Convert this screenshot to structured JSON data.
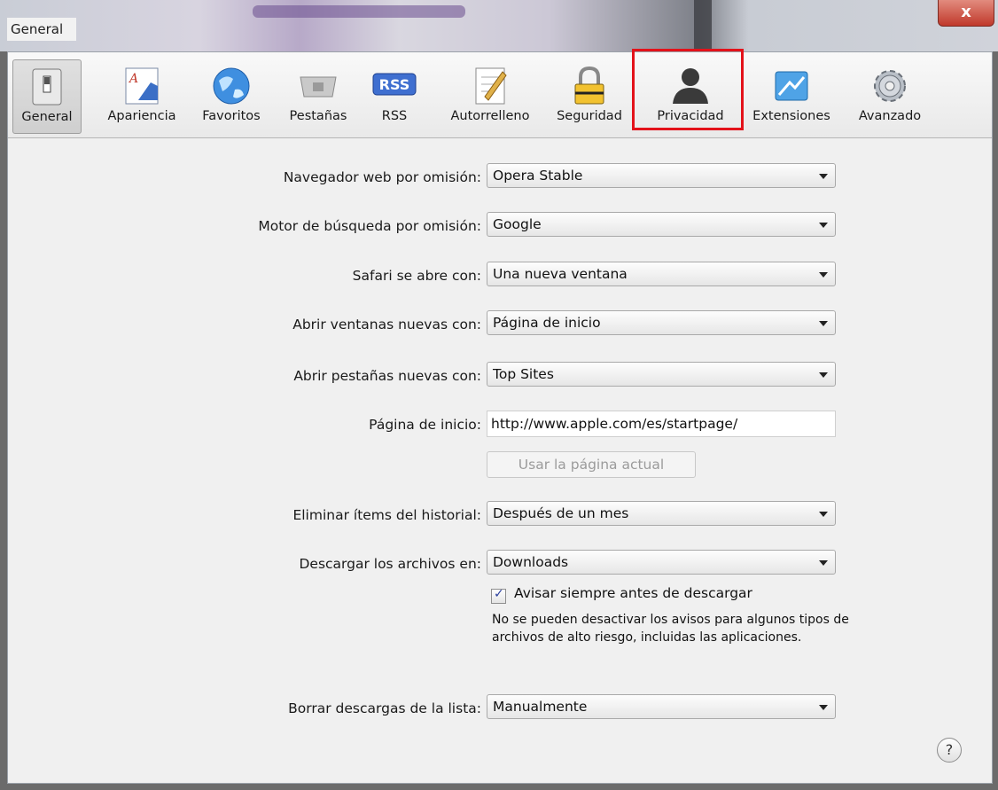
{
  "window": {
    "title": "General",
    "close": "x"
  },
  "toolbar": {
    "items": [
      {
        "label": "General",
        "icon": "switch-icon"
      },
      {
        "label": "Apariencia",
        "icon": "font-icon"
      },
      {
        "label": "Favoritos",
        "icon": "globe-icon"
      },
      {
        "label": "Pestañas",
        "icon": "tabs-icon"
      },
      {
        "label": "RSS",
        "icon": "rss-icon",
        "badge": "RSS"
      },
      {
        "label": "Autorrelleno",
        "icon": "pencil-icon"
      },
      {
        "label": "Seguridad",
        "icon": "lock-icon"
      },
      {
        "label": "Privacidad",
        "icon": "person-icon"
      },
      {
        "label": "Extensiones",
        "icon": "extension-icon"
      },
      {
        "label": "Avanzado",
        "icon": "gear-icon"
      }
    ],
    "selected": "General",
    "highlighted": "Privacidad",
    "highlight_color": "#e3121a"
  },
  "form": {
    "default_browser": {
      "label": "Navegador web por omisión:",
      "value": "Opera Stable"
    },
    "search_engine": {
      "label": "Motor de búsqueda por omisión:",
      "value": "Google"
    },
    "safari_opens": {
      "label": "Safari se abre con:",
      "value": "Una nueva ventana"
    },
    "new_windows": {
      "label": "Abrir ventanas nuevas con:",
      "value": "Página de inicio"
    },
    "new_tabs": {
      "label": "Abrir pestañas nuevas con:",
      "value": "Top Sites"
    },
    "homepage": {
      "label": "Página de inicio:",
      "value": "http://www.apple.com/es/startpage/"
    },
    "use_current_page": "Usar la página actual",
    "remove_history": {
      "label": "Eliminar ítems del historial:",
      "value": "Después de un mes"
    },
    "download_to": {
      "label": "Descargar los archivos en:",
      "value": "Downloads"
    },
    "always_ask": {
      "label": "Avisar siempre antes de descargar",
      "checked": true
    },
    "warning_note": "No se pueden desactivar los avisos para algunos tipos de archivos de alto riesgo, incluidas las aplicaciones.",
    "clear_downloads": {
      "label": "Borrar descargas de la lista:",
      "value": "Manualmente"
    }
  },
  "help": "?"
}
